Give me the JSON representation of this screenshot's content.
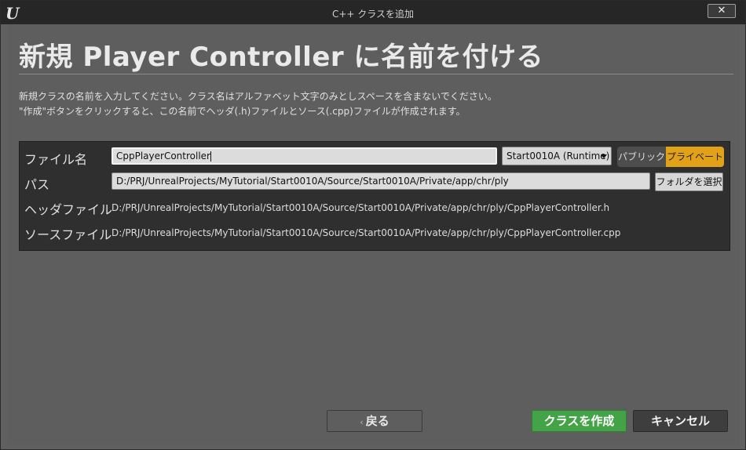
{
  "window": {
    "title": "C++ クラスを追加",
    "close_label": "✕"
  },
  "heading": "新規 Player Controller に名前を付ける",
  "description": [
    "新規クラスの名前を入力してください。クラス名はアルファベット文字のみとしスペースを含まないでください。",
    "\"作成\"ボタンをクリックすると、この名前でヘッダ(.h)ファイルとソース(.cpp)ファイルが作成されます。"
  ],
  "form": {
    "filename_label": "ファイル名",
    "filename_value": "CppPlayerController",
    "module_dropdown": "Start0010A (Runtime)",
    "visibility": {
      "public_label": "パブリック",
      "private_label": "プライベート",
      "selected": "private"
    },
    "path_label": "パス",
    "path_value": "D:/PRJ/UnrealProjects/MyTutorial/Start0010A/Source/Start0010A/Private/app/chr/ply",
    "choose_folder_label": "フォルダを選択",
    "header_label": "ヘッダファイル",
    "header_value": "D:/PRJ/UnrealProjects/MyTutorial/Start0010A/Source/Start0010A/Private/app/chr/ply/CppPlayerController.h",
    "source_label": "ソースファイル",
    "source_value": "D:/PRJ/UnrealProjects/MyTutorial/Start0010A/Source/Start0010A/Private/app/chr/ply/CppPlayerController.cpp"
  },
  "buttons": {
    "back_label": "戻る",
    "create_label": "クラスを作成",
    "cancel_label": "キャンセル"
  },
  "colors": {
    "accent_private": "#e2a218",
    "create_button": "#45a347"
  }
}
